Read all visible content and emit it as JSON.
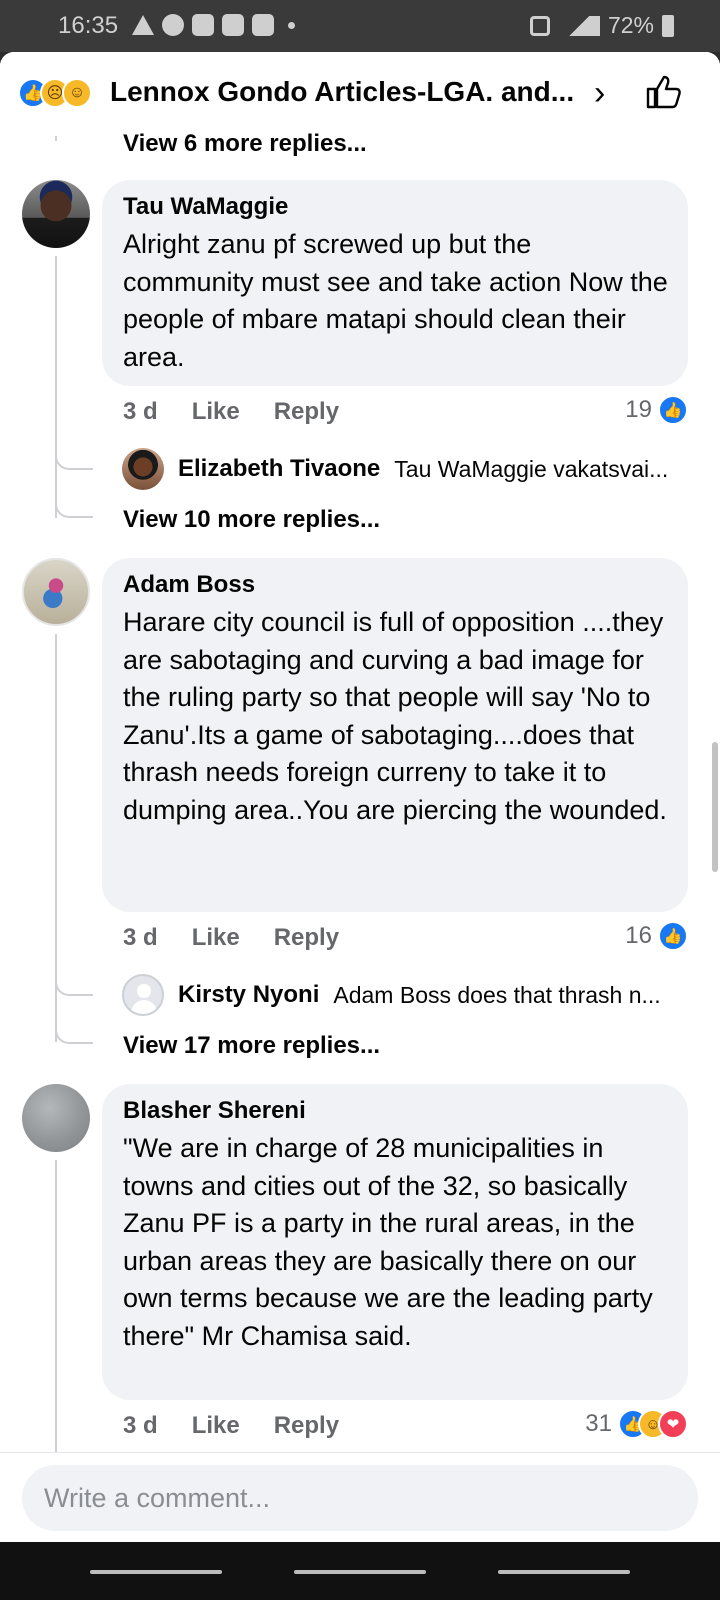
{
  "status_bar": {
    "time": "16:35",
    "battery": "72%"
  },
  "header": {
    "title": "Lennox Gondo Articles-LGA. and...",
    "reactions": [
      "like",
      "sad",
      "haha"
    ]
  },
  "thread": {
    "top_more_replies": "View 6 more replies...",
    "comments": [
      {
        "author": "Tau WaMaggie",
        "text": "Alright zanu pf screwed up but the community must see and take action Now the people of mbare matapi should clean their area.",
        "age": "3 d",
        "like_label": "Like",
        "reply_label": "Reply",
        "reaction_count": "19",
        "reply_preview": {
          "author": "Elizabeth Tivaone",
          "text": "Tau WaMaggie vakatsvai..."
        },
        "more_replies": "View 10 more replies..."
      },
      {
        "author": "Adam Boss",
        "text": "Harare city council is full of opposition ....they are sabotaging and curving a bad image for the ruling party so that people will say 'No to Zanu'.Its a game of sabotaging....does that thrash needs foreign curreny to take it to dumping area..You are piercing the wounded.",
        "age": "3 d",
        "like_label": "Like",
        "reply_label": "Reply",
        "reaction_count": "16",
        "reply_preview": {
          "author": "Kirsty Nyoni",
          "text": "Adam Boss  does that thrash n..."
        },
        "more_replies": "View 17 more replies..."
      },
      {
        "author": "Blasher Shereni",
        "text": "\"We are in charge of 28 municipalities in towns and cities out of the 32, so basically Zanu PF is a party in the rural areas, in the urban areas they are basically there on our own terms because we are the leading party there\" Mr Chamisa said.",
        "age": "3 d",
        "like_label": "Like",
        "reply_label": "Reply",
        "reaction_count": "31"
      }
    ]
  },
  "composer": {
    "placeholder": "Write a comment..."
  },
  "colors": {
    "accent": "#1877f2",
    "bubble": "#f0f2f5",
    "muted": "#65676b",
    "haha": "#f7b928",
    "love": "#f33e58"
  }
}
